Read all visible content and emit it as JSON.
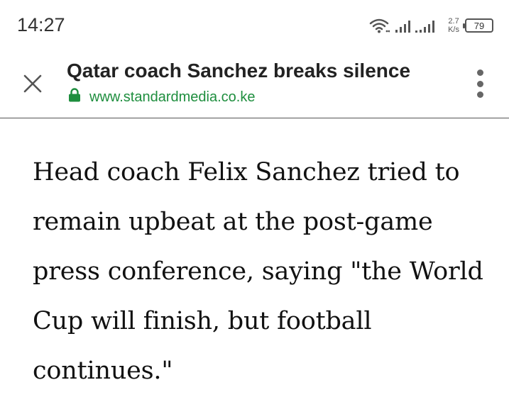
{
  "status_bar": {
    "time": "14:27",
    "net_speed_value": "2.7",
    "net_speed_unit": "K/s",
    "battery_level": "79",
    "icons": [
      "wifi-icon",
      "signal-icon",
      "battery-icon"
    ]
  },
  "toolbar": {
    "title": "Qatar coach Sanchez breaks silence",
    "url": "www.standardmedia.co.ke",
    "close_icon": "close-icon",
    "menu_icon": "more-vertical-icon",
    "lock_icon": "lock-icon",
    "secure_color": "#1e8e3e"
  },
  "article": {
    "paragraph": "Head coach Felix Sanchez tried to remain upbeat at the post-game press conference, saying \"the World Cup will finish, but football continues.\""
  }
}
